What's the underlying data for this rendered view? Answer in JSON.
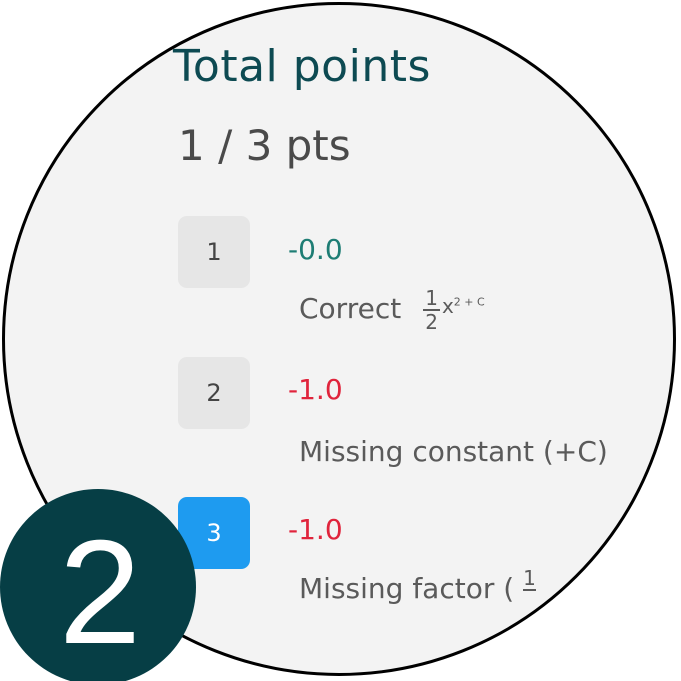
{
  "panel": {
    "title": "Total points",
    "total": "1 / 3 pts"
  },
  "rubric_items": [
    {
      "number": "1",
      "delta": "-0.0",
      "description": "Correct",
      "math": {
        "numerator": "1",
        "denominator": "2",
        "tail": "x",
        "tail_sup": "2 + C"
      },
      "selected": false
    },
    {
      "number": "2",
      "delta": "-1.0",
      "description": "Missing constant (+C)",
      "selected": false
    },
    {
      "number": "3",
      "delta": "-1.0",
      "description": "Missing factor (",
      "math": {
        "numerator": "1",
        "denominator": ""
      },
      "selected": true
    }
  ],
  "step_badge": "2",
  "colors": {
    "title": "#0d4a52",
    "delta_zero": "#1e7d74",
    "delta_negative": "#e0243c",
    "selected_box": "#1e9bf0",
    "badge": "#063e45"
  }
}
